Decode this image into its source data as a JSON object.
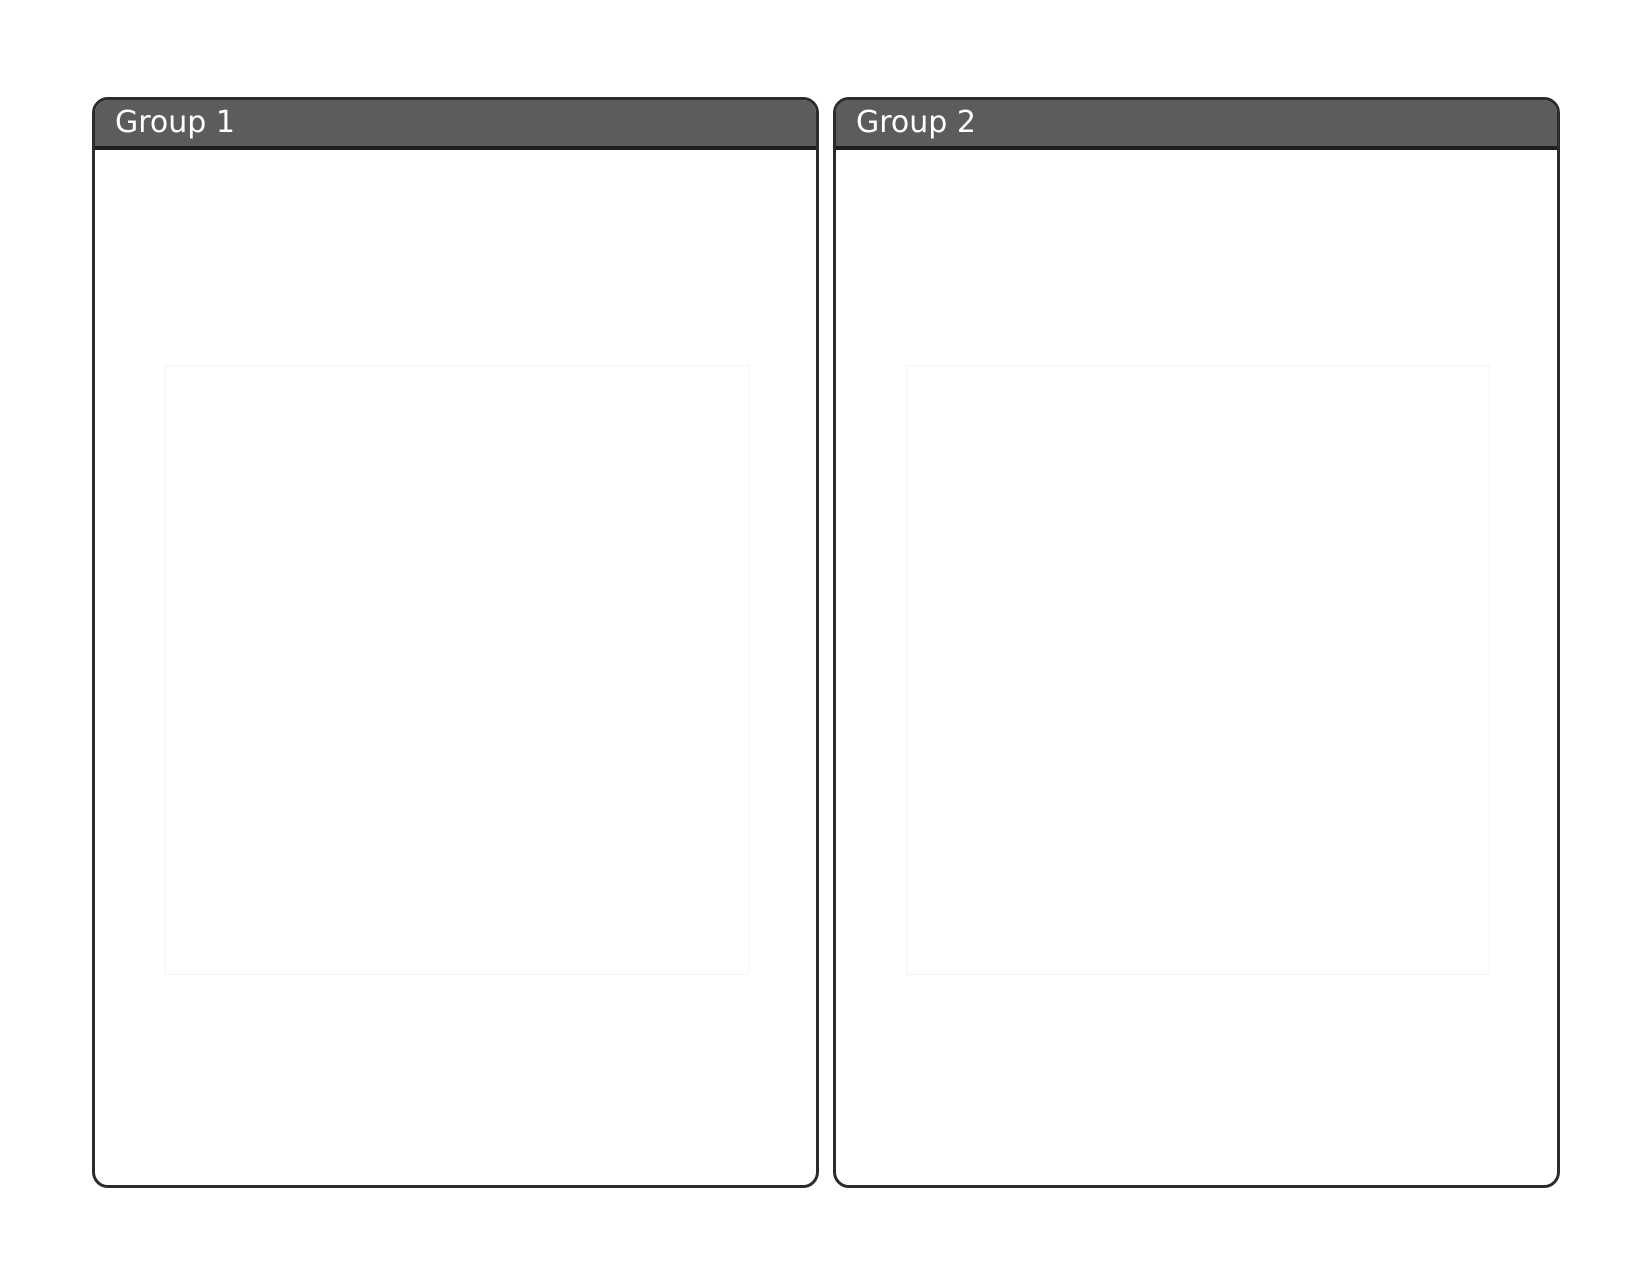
{
  "groups": [
    {
      "title": "Group 1"
    },
    {
      "title": "Group 2"
    }
  ],
  "colors": {
    "header_fill": "#5c5c5c",
    "header_text": "#ffffff",
    "border": "#2b2b2b",
    "background": "#ffffff"
  }
}
